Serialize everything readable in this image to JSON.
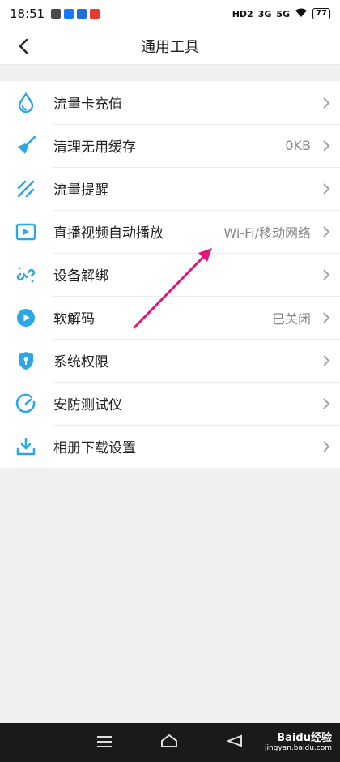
{
  "status_bar": {
    "time": "18:51",
    "network_hd": "HD2",
    "network_3g": "3G",
    "network_5g": "5G",
    "battery": "77"
  },
  "header": {
    "title": "通用工具",
    "back_icon": "chevron-left-icon"
  },
  "menu": {
    "items": [
      {
        "label": "流量卡充值",
        "value": "",
        "icon": "water-drop-icon"
      },
      {
        "label": "清理无用缓存",
        "value": "0KB",
        "icon": "broom-icon"
      },
      {
        "label": "流量提醒",
        "value": "",
        "icon": "traffic-alert-icon"
      },
      {
        "label": "直播视频自动播放",
        "value": "Wi-Fi/移动网络",
        "icon": "video-play-icon"
      },
      {
        "label": "设备解绑",
        "value": "",
        "icon": "unlink-icon"
      },
      {
        "label": "软解码",
        "value": "已关闭",
        "icon": "play-circle-icon"
      },
      {
        "label": "系统权限",
        "value": "",
        "icon": "shield-lock-icon"
      },
      {
        "label": "安防测试仪",
        "value": "",
        "icon": "gauge-icon"
      },
      {
        "label": "相册下载设置",
        "value": "",
        "icon": "download-icon"
      }
    ]
  },
  "colors": {
    "accent": "#2aa7e6",
    "annotation_arrow": "#e0177e",
    "chevron": "#9a9a9a"
  },
  "watermark": {
    "brand": "Baidu经验",
    "url": "jingyan.baidu.com"
  },
  "bottom_nav": {
    "icons": [
      "menu-icon",
      "home-icon",
      "back-icon"
    ]
  }
}
